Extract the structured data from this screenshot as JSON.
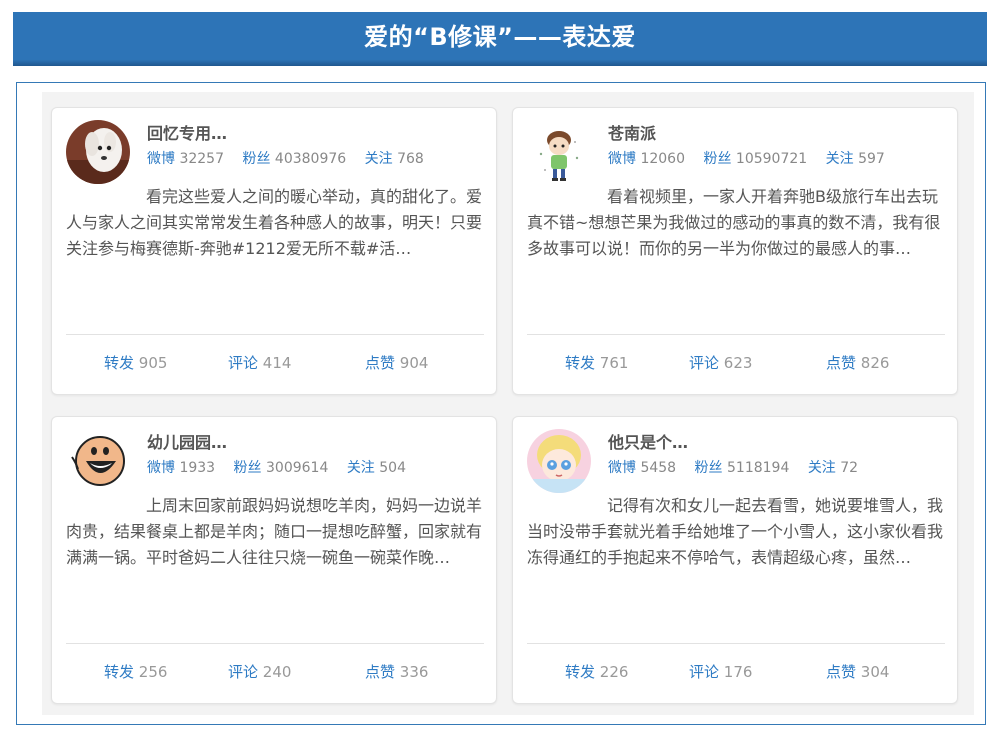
{
  "title": "爱的“B修课”——表达爱",
  "labels": {
    "weibo": "微博",
    "fans": "粉丝",
    "follow": "关注",
    "repost": "转发",
    "comment": "评论",
    "like": "点赞"
  },
  "cards": [
    {
      "name": "回忆专用…",
      "avatar_icon": "dog-photo-icon",
      "weibo": "32257",
      "fans": "40380976",
      "follow": "768",
      "text": "看完这些爱人之间的暖心举动，真的甜化了。爱人与家人之间其实常常发生着各种感人的故事，明天！只要关注参与梅赛德斯-奔驰#1212爱无所不载#活…",
      "repost": "905",
      "comment": "414",
      "like": "904"
    },
    {
      "name": "苍南派",
      "avatar_icon": "cartoon-boy-icon",
      "weibo": "12060",
      "fans": "10590721",
      "follow": "597",
      "text": "看着视频里，一家人开着奔驰B级旅行车出去玩真不错~想想芒果为我做过的感动的事真的数不清，我有很多故事可以说！而你的另一半为你做过的最感人的事…",
      "repost": "761",
      "comment": "623",
      "like": "826"
    },
    {
      "name": "幼儿园园…",
      "avatar_icon": "cartoon-face-icon",
      "weibo": "1933",
      "fans": "3009614",
      "follow": "504",
      "text": "上周末回家前跟妈妈说想吃羊肉，妈妈一边说羊肉贵，结果餐桌上都是羊肉；随口一提想吃醉蟹，回家就有满满一锅。平时爸妈二人往往只烧一碗鱼一碗菜作晚…",
      "repost": "256",
      "comment": "240",
      "like": "336"
    },
    {
      "name": "他只是个…",
      "avatar_icon": "anime-girl-icon",
      "weibo": "5458",
      "fans": "5118194",
      "follow": "72",
      "text": "记得有次和女儿一起去看雪，她说要堆雪人，我当时没带手套就光着手给她堆了一个小雪人，这小家伙看我冻得通红的手抱起来不停哈气，表情超级心疼，虽然…",
      "repost": "226",
      "comment": "176",
      "like": "304"
    }
  ]
}
